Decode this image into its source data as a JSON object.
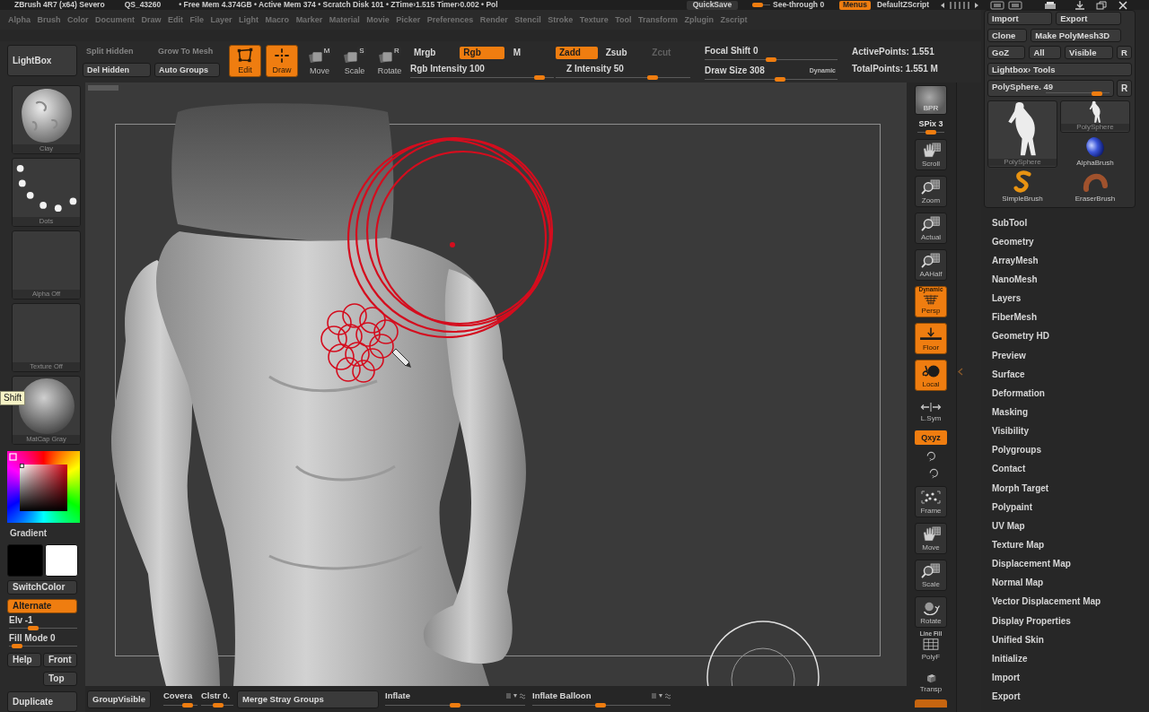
{
  "title_bar": {
    "app_title": "ZBrush 4R7 (x64) Severo",
    "document": "QS_43260",
    "stats": "• Free Mem 4.374GB • Active Mem 374 • Scratch Disk 101 • ZTime›1.515 Timer›0.002 • Pol",
    "quicksave": "QuickSave",
    "see_through": {
      "label": "See-through 0",
      "level": 0.03
    },
    "menus": {
      "label": "Menus",
      "on": true
    },
    "zscript": "DefaultZScript"
  },
  "menu_bar": [
    "Alpha",
    "Brush",
    "Color",
    "Document",
    "Draw",
    "Edit",
    "File",
    "Layer",
    "Light",
    "Macro",
    "Marker",
    "Material",
    "Movie",
    "Picker",
    "Preferences",
    "Render",
    "Stencil",
    "Stroke",
    "Texture",
    "Tool",
    "Transform",
    "Zplugin",
    "Zscript"
  ],
  "top_shelf": {
    "lightbox": "LightBox",
    "mesh_buttons": [
      {
        "label": "Split Hidden",
        "disabled": true
      },
      {
        "label": "Grow To Mesh",
        "disabled": true
      },
      {
        "label": "Del Hidden",
        "disabled": false
      },
      {
        "label": "Auto Groups",
        "disabled": false
      }
    ],
    "modes": [
      {
        "kind": "edit",
        "label": "Edit",
        "on": true
      },
      {
        "kind": "draw",
        "label": "Draw",
        "on": true
      },
      {
        "kind": "move",
        "badge": "M",
        "label": "Move",
        "on": false
      },
      {
        "kind": "scale",
        "badge": "S",
        "label": "Scale",
        "on": false
      },
      {
        "kind": "rotate",
        "badge": "R",
        "label": "Rotate",
        "on": false
      }
    ],
    "color_modes": [
      {
        "label": "Mrgb",
        "on": false
      },
      {
        "label": "Rgb",
        "on": true
      },
      {
        "label": "M",
        "on": false
      }
    ],
    "rgb_intensity": {
      "label": "Rgb Intensity 100",
      "level": 0.93
    },
    "z_modes": [
      {
        "label": "Zadd",
        "selected": true,
        "disabled": false
      },
      {
        "label": "Zsub",
        "selected": false,
        "disabled": false
      },
      {
        "label": "Zcut",
        "selected": false,
        "disabled": true
      }
    ],
    "z_intensity": {
      "label": "Z Intensity 50",
      "level": 0.74
    },
    "focal_shift": {
      "label": "Focal Shift 0",
      "level": 0.5
    },
    "draw_size": {
      "label": "Draw Size 308",
      "level": 0.57
    },
    "dynamic": "Dynamic",
    "points": [
      "ActivePoints: 1.551",
      "TotalPoints: 1.551 M"
    ]
  },
  "left_shelf": {
    "thumbnails": [
      {
        "kind": "brush",
        "label": "Clay"
      },
      {
        "kind": "stroke",
        "label": "Dots"
      },
      {
        "kind": "alpha",
        "label": "Alpha Off"
      },
      {
        "kind": "texture",
        "label": "Texture Off"
      },
      {
        "kind": "material",
        "label": "MatCap Gray"
      }
    ],
    "tooltip": "Shift",
    "gradient": "Gradient",
    "swatches": [
      {
        "color": "#000000"
      },
      {
        "color": "#ffffff"
      }
    ],
    "switch_color": "SwitchColor",
    "alternate": {
      "label": "Alternate",
      "on": true
    },
    "elevation": {
      "label": "Elv -1",
      "level": 0.33
    },
    "fill_mode": {
      "label": "Fill Mode 0",
      "level": 0.04
    },
    "view_buttons": [
      "Help",
      "Front",
      "Top"
    ],
    "duplicate": "Duplicate"
  },
  "right_shelf": [
    {
      "kind": "bpr",
      "label": "BPR"
    },
    {
      "kind": "spix",
      "label": "SPix 3",
      "level": 0.5
    },
    {
      "kind": "scroll",
      "label": "Scroll",
      "on": false
    },
    {
      "kind": "zoom",
      "label": "Zoom",
      "on": false
    },
    {
      "kind": "actual",
      "label": "Actual",
      "on": false
    },
    {
      "kind": "aahalf",
      "label": "AAHalf",
      "on": false
    },
    {
      "kind": "persp",
      "caption": "Dynamic",
      "label": "Persp",
      "on": true
    },
    {
      "kind": "floor",
      "label": "Floor",
      "on": true
    },
    {
      "kind": "local",
      "label": "Local",
      "on": true
    },
    {
      "kind": "lsym",
      "label": "L.Sym",
      "on": false
    },
    {
      "kind": "qxyz",
      "label": "Qxyz",
      "on": true
    },
    {
      "kind": "rotate_y"
    },
    {
      "kind": "rotate_z"
    },
    {
      "kind": "frame",
      "label": "Frame",
      "on": false
    },
    {
      "kind": "move",
      "label": "Move",
      "on": false
    },
    {
      "kind": "scale",
      "label": "Scale",
      "on": false
    },
    {
      "kind": "rotate",
      "label": "Rotate",
      "on": false
    },
    {
      "kind": "polyf",
      "caption": "Line Fill",
      "label": "PolyF",
      "on": false
    },
    {
      "kind": "transp",
      "label": "Transp",
      "on": false
    },
    {
      "kind": "stub",
      "on": true
    }
  ],
  "tool_palette": {
    "button_rows": [
      [
        "Import",
        "Export"
      ],
      [
        "Clone",
        "Make PolyMesh3D"
      ],
      [
        "GoZ",
        "All",
        "Visible",
        "R"
      ],
      [
        "Lightbox› Tools"
      ]
    ],
    "current_tool": {
      "label": "PolySphere. 49",
      "level": 0.86
    },
    "reset": "R",
    "thumbnails": [
      {
        "kind": "mesh",
        "label": "PolySphere"
      },
      {
        "kind": "mesh",
        "label": "PolySphere"
      },
      {
        "kind": "alpha-brush",
        "label": "AlphaBrush"
      },
      {
        "kind": "simple-brush",
        "label": "SimpleBrush"
      },
      {
        "kind": "eraser-brush",
        "label": "EraserBrush"
      }
    ],
    "sections": [
      "SubTool",
      "Geometry",
      "ArrayMesh",
      "NanoMesh",
      "Layers",
      "FiberMesh",
      "Geometry HD",
      "Preview",
      "Surface",
      "Deformation",
      "Masking",
      "Visibility",
      "Polygroups",
      "Contact",
      "Morph Target",
      "Polypaint",
      "UV Map",
      "Texture Map",
      "Displacement Map",
      "Normal Map",
      "Vector Displacement Map",
      "Display Properties",
      "Unified Skin",
      "Initialize",
      "Import",
      "Export"
    ]
  },
  "bottom_bar": {
    "group_visible": "GroupVisible",
    "coverage": {
      "label": "Covera",
      "level": 0.8
    },
    "cluster": {
      "label": "Clstr 0.",
      "level": 0.55
    },
    "merge_stray_groups": "Merge Stray Groups",
    "inflate": {
      "label": "Inflate",
      "level": 0.5
    },
    "inflate_balloon": {
      "label": "Inflate Balloon",
      "level": 0.49
    }
  }
}
